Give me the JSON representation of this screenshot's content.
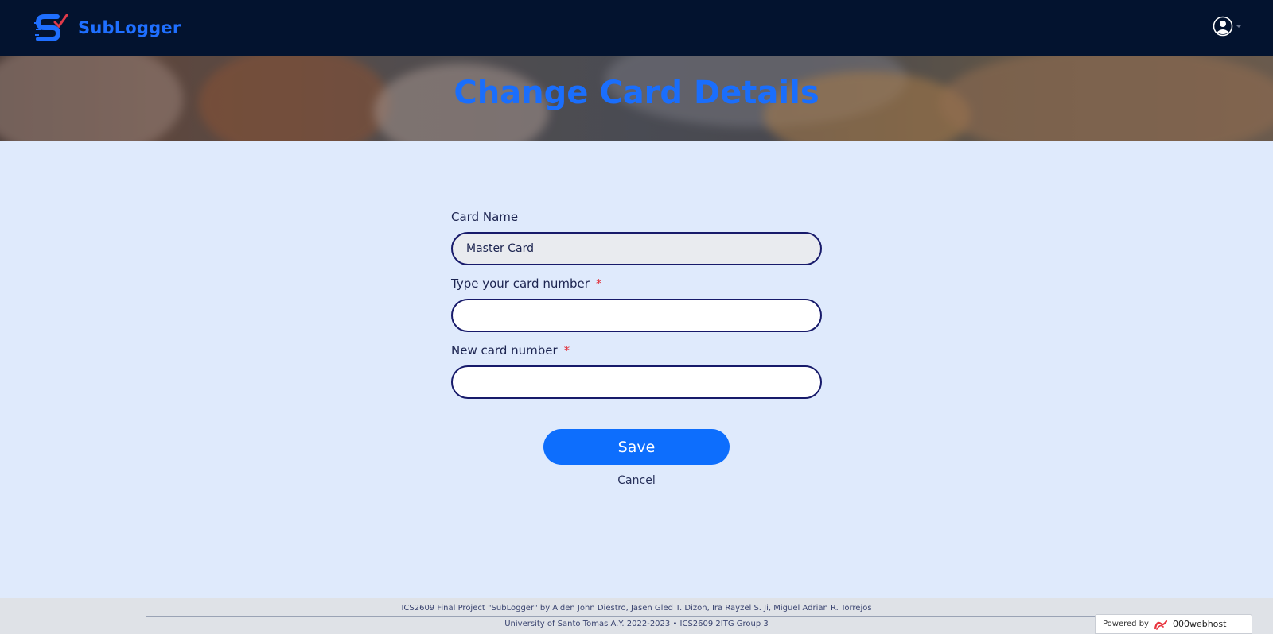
{
  "navbar": {
    "brand_name": "SubLogger",
    "logo_icon": "sublogger-logo-icon",
    "profile_icon": "user-circle-icon"
  },
  "hero": {
    "title": "Change Card Details"
  },
  "form": {
    "card_name_label": "Card Name",
    "card_name_value": "Master Card",
    "current_number_label": "Type your card number",
    "current_number_value": "",
    "new_number_label": "New card number",
    "new_number_value": "",
    "required_marker": "*"
  },
  "actions": {
    "save_label": "Save",
    "cancel_label": "Cancel"
  },
  "footer": {
    "line1": "ICS2609 Final Project \"SubLogger\" by Alden John Diestro, Jasen Gled T. Dizon, Ira Rayzel S. Ji, Miguel Adrian R. Torrejos",
    "line2": "University of Santo Tomas A.Y. 2022-2023 • ICS2609 2ITG Group 3"
  },
  "badge": {
    "powered_by": "Powered by",
    "host_name": "000webhost"
  },
  "colors": {
    "navbar_bg": "#03132f",
    "accent": "#0d6efd",
    "page_bg": "#dfeafc",
    "required": "#e0303a"
  }
}
